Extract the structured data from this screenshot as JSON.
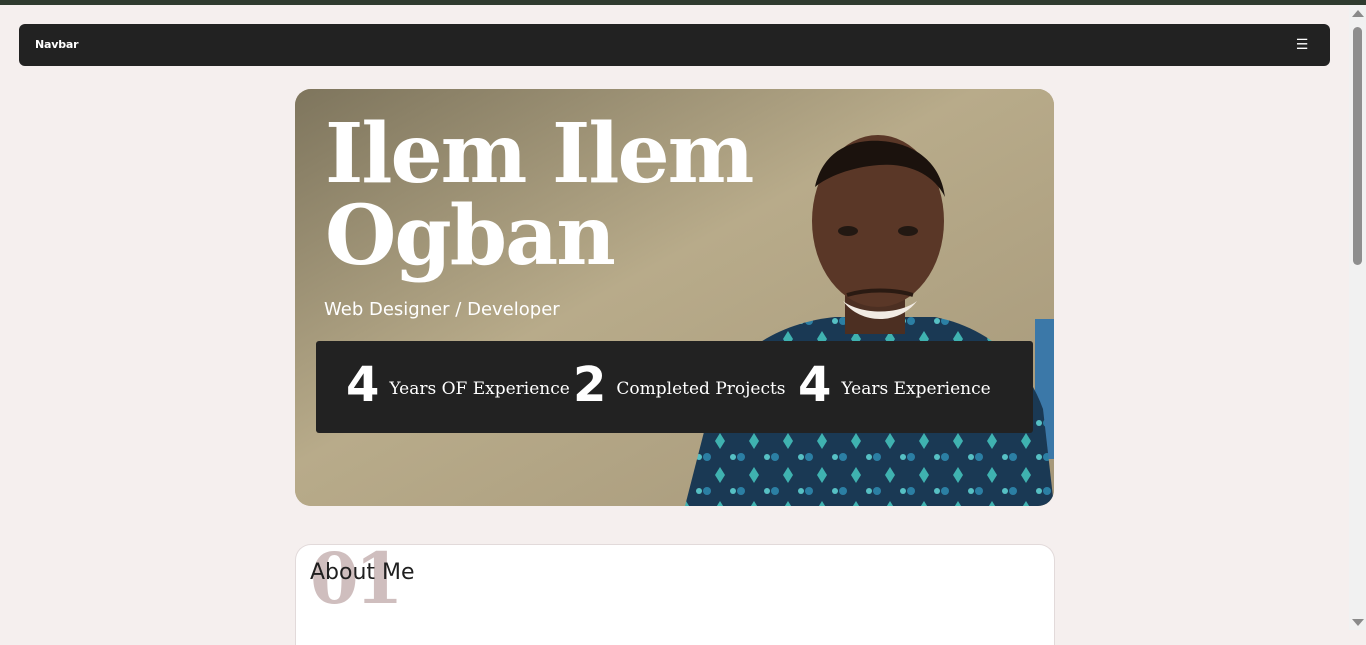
{
  "navbar": {
    "brand": "Navbar",
    "menu_icon": "hamburger-menu-icon",
    "menu_glyph": "☰"
  },
  "hero": {
    "name": "Ilem Ilem Ogban",
    "role": "Web Designer / Developer",
    "stats": [
      {
        "number": "4",
        "label": "Years OF Experience"
      },
      {
        "number": "2",
        "label": "Completed Projects"
      },
      {
        "number": "4",
        "label": "Years Experience"
      }
    ]
  },
  "about": {
    "index": "01",
    "title": "About Me"
  },
  "colors": {
    "page_background": "#f5efee",
    "navbar_background": "#222222",
    "stats_background": "#222222",
    "accent_number": "#cfbebe",
    "text_light": "#ffffff",
    "text_dark": "#1f1f1f"
  }
}
